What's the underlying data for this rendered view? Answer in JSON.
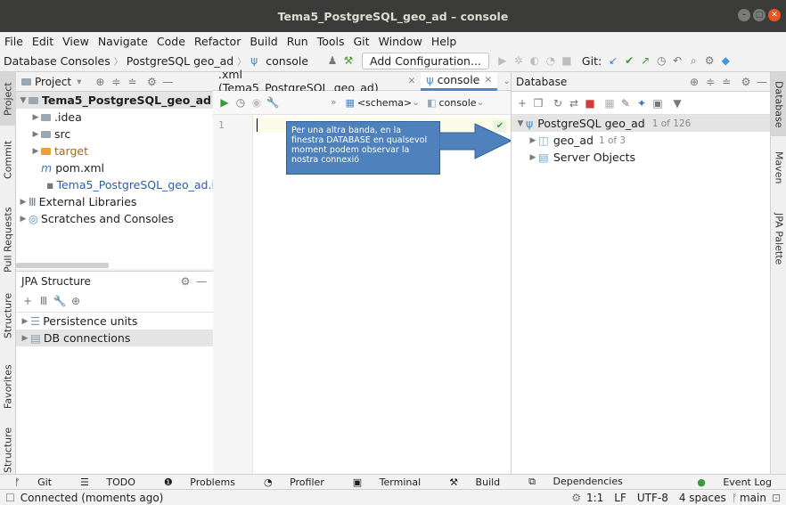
{
  "window": {
    "title": "Tema5_PostgreSQL_geo_ad – console"
  },
  "menu": [
    "File",
    "Edit",
    "View",
    "Navigate",
    "Code",
    "Refactor",
    "Build",
    "Run",
    "Tools",
    "Git",
    "Window",
    "Help"
  ],
  "navbar": {
    "crumbs": [
      "Database Consoles",
      "PostgreSQL geo_ad",
      "console"
    ],
    "config_button": "Add Configuration...",
    "git_label": "Git:"
  },
  "left_tools": [
    "Project",
    "Commit",
    "Pull Requests",
    "Structure",
    "Favorites",
    "Structure"
  ],
  "right_tools": [
    "Database",
    "Maven",
    "JPA Palette"
  ],
  "project": {
    "header": "Project",
    "root": "Tema5_PostgreSQL_geo_ad",
    "items": [
      ".idea",
      "src",
      "target",
      "pom.xml",
      "Tema5_PostgreSQL_geo_ad.i",
      "External Libraries",
      "Scratches and Consoles"
    ]
  },
  "jpa": {
    "header": "JPA Structure",
    "items": [
      "Persistence units",
      "DB connections"
    ]
  },
  "editor": {
    "tabs": [
      ".xml (Tema5_PostgreSQL_geo_ad)",
      "console"
    ],
    "schema": "<schema>",
    "session": "console",
    "line_number": "1"
  },
  "callout": {
    "text": "Per una altra banda, en la finestra DATABASE en qualsevol moment podem observar la nostra connexió"
  },
  "database": {
    "header": "Database",
    "root": "PostgreSQL geo_ad",
    "root_count": "1 of 126",
    "children": [
      {
        "label": "geo_ad",
        "count": "1 of 3"
      },
      {
        "label": "Server Objects",
        "count": ""
      }
    ]
  },
  "bottom_tools": [
    "Git",
    "TODO",
    "Problems",
    "Profiler",
    "Terminal",
    "Build",
    "Dependencies",
    "Event Log"
  ],
  "status": {
    "message": "Connected (moments ago)",
    "position": "1:1",
    "line_sep": "LF",
    "encoding": "UTF-8",
    "indent": "4 spaces",
    "branch": "main"
  },
  "colors": {
    "accent": "#4a88c7",
    "callout": "#4f81bd",
    "titlebar": "#3b3b39"
  }
}
